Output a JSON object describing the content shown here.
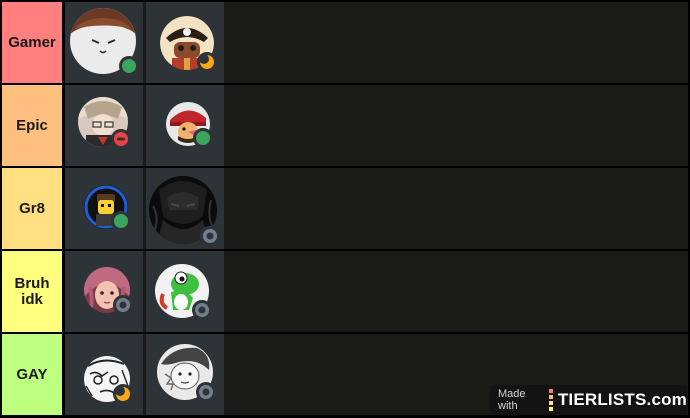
{
  "tiers": [
    {
      "label": "Gamer",
      "color": "#ff7f7f",
      "items": [
        {
          "avatar": "white-blob-face-avatar",
          "status": "online"
        },
        {
          "avatar": "pirate-character-avatar",
          "status": "idle"
        }
      ]
    },
    {
      "label": "Epic",
      "color": "#ffbf7f",
      "items": [
        {
          "avatar": "anime-girl-glasses-avatar",
          "status": "do-not-disturb"
        },
        {
          "avatar": "red-cap-character-avatar",
          "status": "online"
        }
      ]
    },
    {
      "label": "Gr8",
      "color": "#ffdf7f",
      "items": [
        {
          "avatar": "lego-figure-avatar",
          "status": "online"
        },
        {
          "avatar": "dark-knight-avatar",
          "status": "offline"
        }
      ]
    },
    {
      "label": "Bruh\nidk",
      "color": "#ffff7f",
      "items": [
        {
          "avatar": "pink-hair-girl-avatar",
          "status": "offline"
        },
        {
          "avatar": "yoshi-avatar",
          "status": "offline"
        }
      ]
    },
    {
      "label": "GAY",
      "color": "#bfff7f",
      "items": [
        {
          "avatar": "sketch-face-avatar",
          "status": "idle"
        },
        {
          "avatar": "sketch-character-avatar",
          "status": "offline"
        }
      ]
    }
  ],
  "status_colors": {
    "online": "#3ba55d",
    "idle": "#faa81a",
    "do-not-disturb": "#ed4245",
    "offline": "#747f8d"
  },
  "watermark": {
    "prefix": "Made with",
    "brand": "TIERLISTS.com",
    "bar_colors": [
      "#ff7f7f",
      "#ffbf7f",
      "#ffdf7f",
      "#ffff7f",
      "#bfff7f"
    ]
  }
}
